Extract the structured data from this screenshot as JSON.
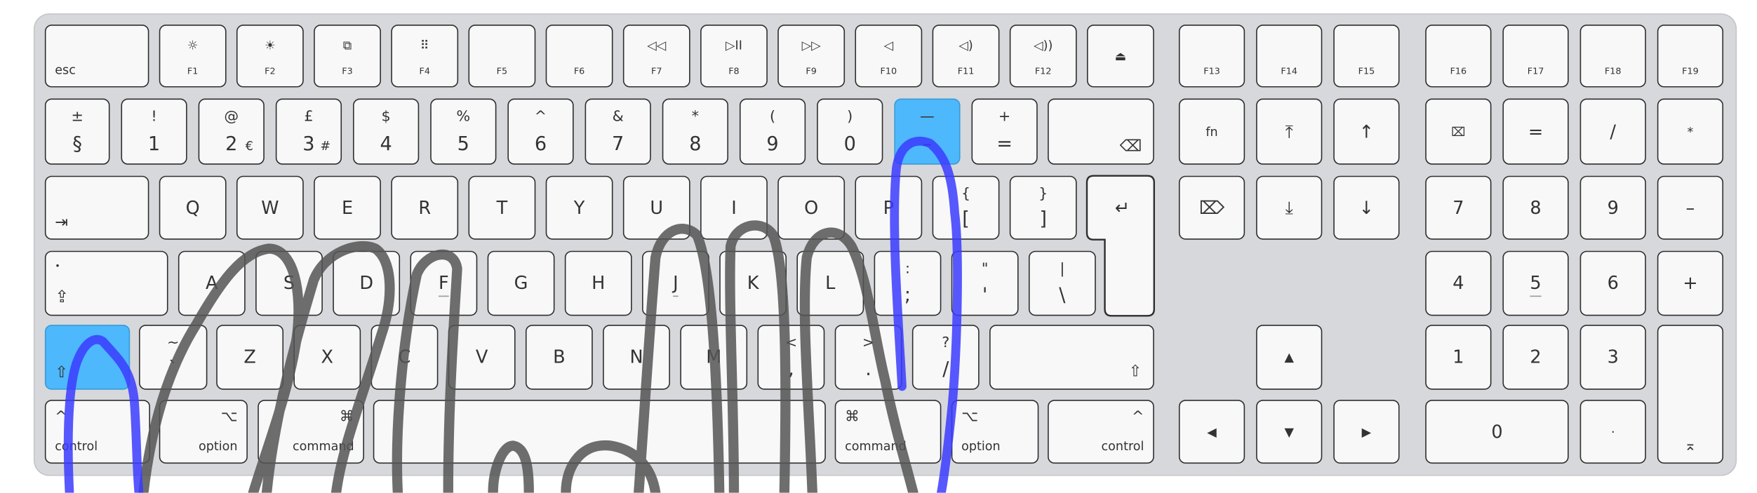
{
  "highlight_color": "#4db8fb",
  "stroke_colors": {
    "left_hand": "#555555",
    "pinky_path": "#3b3bff"
  },
  "keys": {
    "esc": {
      "label": "esc"
    },
    "f1": {
      "label": "F1",
      "symbol": "☼",
      "icon": "brightness-down-icon"
    },
    "f2": {
      "label": "F2",
      "symbol": "☀",
      "icon": "brightness-up-icon"
    },
    "f3": {
      "label": "F3",
      "symbol": "⧉",
      "icon": "mission-control-icon"
    },
    "f4": {
      "label": "F4",
      "symbol": "⠿",
      "icon": "launchpad-icon"
    },
    "f5": {
      "label": "F5"
    },
    "f6": {
      "label": "F6"
    },
    "f7": {
      "label": "F7",
      "symbol": "◁◁",
      "icon": "rewind-icon"
    },
    "f8": {
      "label": "F8",
      "symbol": "▷II",
      "icon": "play-pause-icon"
    },
    "f9": {
      "label": "F9",
      "symbol": "▷▷",
      "icon": "fast-forward-icon"
    },
    "f10": {
      "label": "F10",
      "symbol": "◁",
      "icon": "mute-icon"
    },
    "f11": {
      "label": "F11",
      "symbol": "◁)",
      "icon": "volume-down-icon"
    },
    "f12": {
      "label": "F12",
      "symbol": "◁))",
      "icon": "volume-up-icon"
    },
    "eject": {
      "symbol": "⏏",
      "icon": "eject-icon"
    },
    "f13": {
      "label": "F13"
    },
    "f14": {
      "label": "F14"
    },
    "f15": {
      "label": "F15"
    },
    "f16": {
      "label": "F16"
    },
    "f17": {
      "label": "F17"
    },
    "f18": {
      "label": "F18"
    },
    "f19": {
      "label": "F19"
    },
    "section": {
      "top": "±",
      "bottom": "§"
    },
    "n1": {
      "top": "!",
      "bottom": "1"
    },
    "n2": {
      "top": "@",
      "bottom": "2",
      "extra": "€"
    },
    "n3": {
      "top": "£",
      "bottom": "3",
      "extra": "#"
    },
    "n4": {
      "top": "$",
      "bottom": "4"
    },
    "n5": {
      "top": "%",
      "bottom": "5"
    },
    "n6": {
      "top": "^",
      "bottom": "6"
    },
    "n7": {
      "top": "&",
      "bottom": "7"
    },
    "n8": {
      "top": "*",
      "bottom": "8"
    },
    "n9": {
      "top": "(",
      "bottom": "9"
    },
    "n0": {
      "top": ")",
      "bottom": "0"
    },
    "minus": {
      "top": "—",
      "bottom": "–",
      "highlighted": true
    },
    "equals": {
      "top": "+",
      "bottom": "="
    },
    "delete": {
      "symbol": "⌫",
      "icon": "delete-icon"
    },
    "tab": {
      "symbol": "⇥",
      "icon": "tab-icon"
    },
    "q": {
      "label": "Q"
    },
    "w": {
      "label": "W"
    },
    "e": {
      "label": "E"
    },
    "r": {
      "label": "R"
    },
    "t": {
      "label": "T"
    },
    "y": {
      "label": "Y"
    },
    "u": {
      "label": "U"
    },
    "i": {
      "label": "I"
    },
    "o": {
      "label": "O"
    },
    "p": {
      "label": "P"
    },
    "lbracket": {
      "top": "{",
      "bottom": "["
    },
    "rbracket": {
      "top": "}",
      "bottom": "]"
    },
    "return": {
      "symbol": "↵",
      "icon": "return-icon"
    },
    "caps": {
      "dot": "•",
      "symbol": "⇪",
      "icon": "caps-lock-icon"
    },
    "a": {
      "label": "A"
    },
    "s": {
      "label": "S"
    },
    "d": {
      "label": "D"
    },
    "f": {
      "label": "F"
    },
    "g": {
      "label": "G"
    },
    "h": {
      "label": "H"
    },
    "j": {
      "label": "J"
    },
    "k": {
      "label": "K"
    },
    "l": {
      "label": "L"
    },
    "semicolon": {
      "top": ":",
      "bottom": ";"
    },
    "quote": {
      "top": "\"",
      "bottom": "'"
    },
    "backslash": {
      "top": "|",
      "bottom": "\\"
    },
    "lshift": {
      "symbol": "⇧",
      "icon": "shift-icon",
      "highlighted": true
    },
    "grave": {
      "top": "~",
      "bottom": "`"
    },
    "z": {
      "label": "Z"
    },
    "x": {
      "label": "X"
    },
    "c": {
      "label": "C"
    },
    "v": {
      "label": "V"
    },
    "b": {
      "label": "B"
    },
    "n": {
      "label": "N"
    },
    "m": {
      "label": "M"
    },
    "comma": {
      "top": "<",
      "bottom": ","
    },
    "period": {
      "top": ">",
      "bottom": "."
    },
    "slash": {
      "top": "?",
      "bottom": "/"
    },
    "rshift": {
      "symbol": "⇧",
      "icon": "shift-icon"
    },
    "lcontrol": {
      "label": "control",
      "symbol": "^"
    },
    "loption": {
      "label": "option",
      "symbol": "⌥"
    },
    "lcommand": {
      "label": "command",
      "symbol": "⌘"
    },
    "space": {},
    "rcommand": {
      "label": "command",
      "symbol": "⌘"
    },
    "roption": {
      "label": "option",
      "symbol": "⌥"
    },
    "rcontrol": {
      "label": "control",
      "symbol": "^"
    },
    "fn": {
      "label": "fn"
    },
    "home": {
      "label": "⤒",
      "icon": "home-icon"
    },
    "pageup": {
      "label": "↑",
      "icon": "page-up-icon"
    },
    "fwddelete": {
      "label": "⌦",
      "icon": "forward-delete-icon"
    },
    "end": {
      "label": "⤓",
      "icon": "end-icon"
    },
    "pagedown": {
      "label": "↓",
      "icon": "page-down-icon"
    },
    "up": {
      "label": "▲",
      "icon": "arrow-up-icon"
    },
    "left": {
      "label": "◀",
      "icon": "arrow-left-icon"
    },
    "down": {
      "label": "▼",
      "icon": "arrow-down-icon"
    },
    "right": {
      "label": "▶",
      "icon": "arrow-right-icon"
    },
    "clear": {
      "label": "⌧",
      "icon": "clear-icon"
    },
    "kp_eq": {
      "label": "="
    },
    "kp_div": {
      "label": "/"
    },
    "kp_mul": {
      "label": "*"
    },
    "kp7": {
      "label": "7"
    },
    "kp8": {
      "label": "8"
    },
    "kp9": {
      "label": "9"
    },
    "kp_minus": {
      "label": "–"
    },
    "kp4": {
      "label": "4"
    },
    "kp5": {
      "label": "5"
    },
    "kp6": {
      "label": "6"
    },
    "kp_plus": {
      "label": "+"
    },
    "kp1": {
      "label": "1"
    },
    "kp2": {
      "label": "2"
    },
    "kp3": {
      "label": "3"
    },
    "kp0": {
      "label": "0"
    },
    "kp_dot": {
      "label": "·"
    },
    "kp_enter": {
      "label": "⌅",
      "icon": "enter-icon"
    }
  }
}
